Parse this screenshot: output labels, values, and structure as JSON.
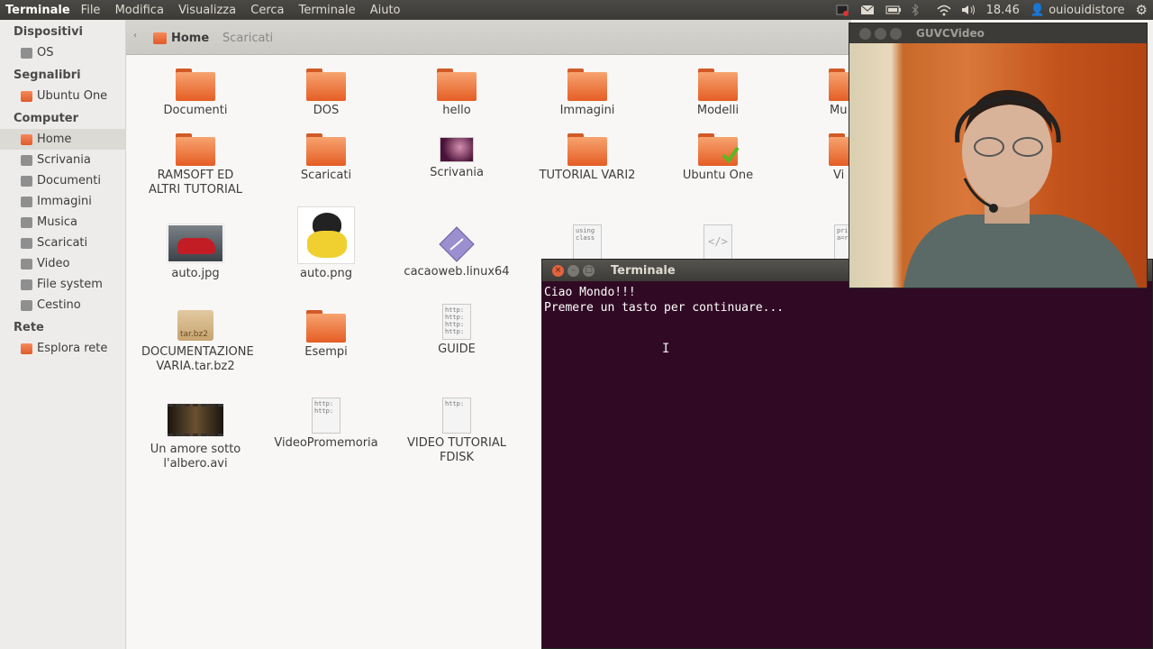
{
  "topbar": {
    "app_name": "Terminale",
    "menu": [
      "File",
      "Modifica",
      "Visualizza",
      "Cerca",
      "Terminale",
      "Aiuto"
    ],
    "time": "18.46",
    "user": "ouiouidistore"
  },
  "sidebar": {
    "sections": [
      {
        "title": "Dispositivi",
        "items": [
          "OS"
        ]
      },
      {
        "title": "Segnalibri",
        "items": [
          "Ubuntu One"
        ]
      },
      {
        "title": "Computer",
        "items": [
          "Home",
          "Scrivania",
          "Documenti",
          "Immagini",
          "Musica",
          "Scaricati",
          "Video",
          "File system",
          "Cestino"
        ]
      },
      {
        "title": "Rete",
        "items": [
          "Esplora rete"
        ]
      }
    ]
  },
  "pathbar": {
    "crumbs": [
      "Home",
      "Scaricati"
    ]
  },
  "files": {
    "row1": [
      "Documenti",
      "DOS",
      "hello",
      "Immagini",
      "Modelli",
      "Mu"
    ],
    "row2": [
      "RAMSOFT ED ALTRI TUTORIAL",
      "Scaricati",
      "Scrivania",
      "TUTORIAL VARI2",
      "Ubuntu One",
      "Vi"
    ],
    "row3": [
      "auto.jpg",
      "auto.png",
      "cacaoweb.linux64"
    ],
    "row4": [
      "DOCUMENTAZIONE VARIA.tar.bz2",
      "Esempi",
      "GUIDE"
    ],
    "row5": [
      "Un amore sotto l'albero.avi",
      "VideoPromemoria",
      "VIDEO TUTORIAL FDISK"
    ],
    "doc_snippets": {
      "using": "using\nclass",
      "http4": "http:\nhttp:\nhttp:\nhttp:",
      "http2": "http:\nhttp:",
      "http1": "http:",
      "pri": "pri\na=ra",
      "tarlabel": "tar.bz2"
    }
  },
  "terminal": {
    "title": "Terminale",
    "lines": [
      "Ciao Mondo!!!",
      "Premere un tasto per continuare..."
    ]
  },
  "guvc": {
    "title": "GUVCVideo"
  },
  "colors": {
    "terminal_bg": "#300a24",
    "folder": "#e55d25",
    "panel": "#3c3b37"
  }
}
